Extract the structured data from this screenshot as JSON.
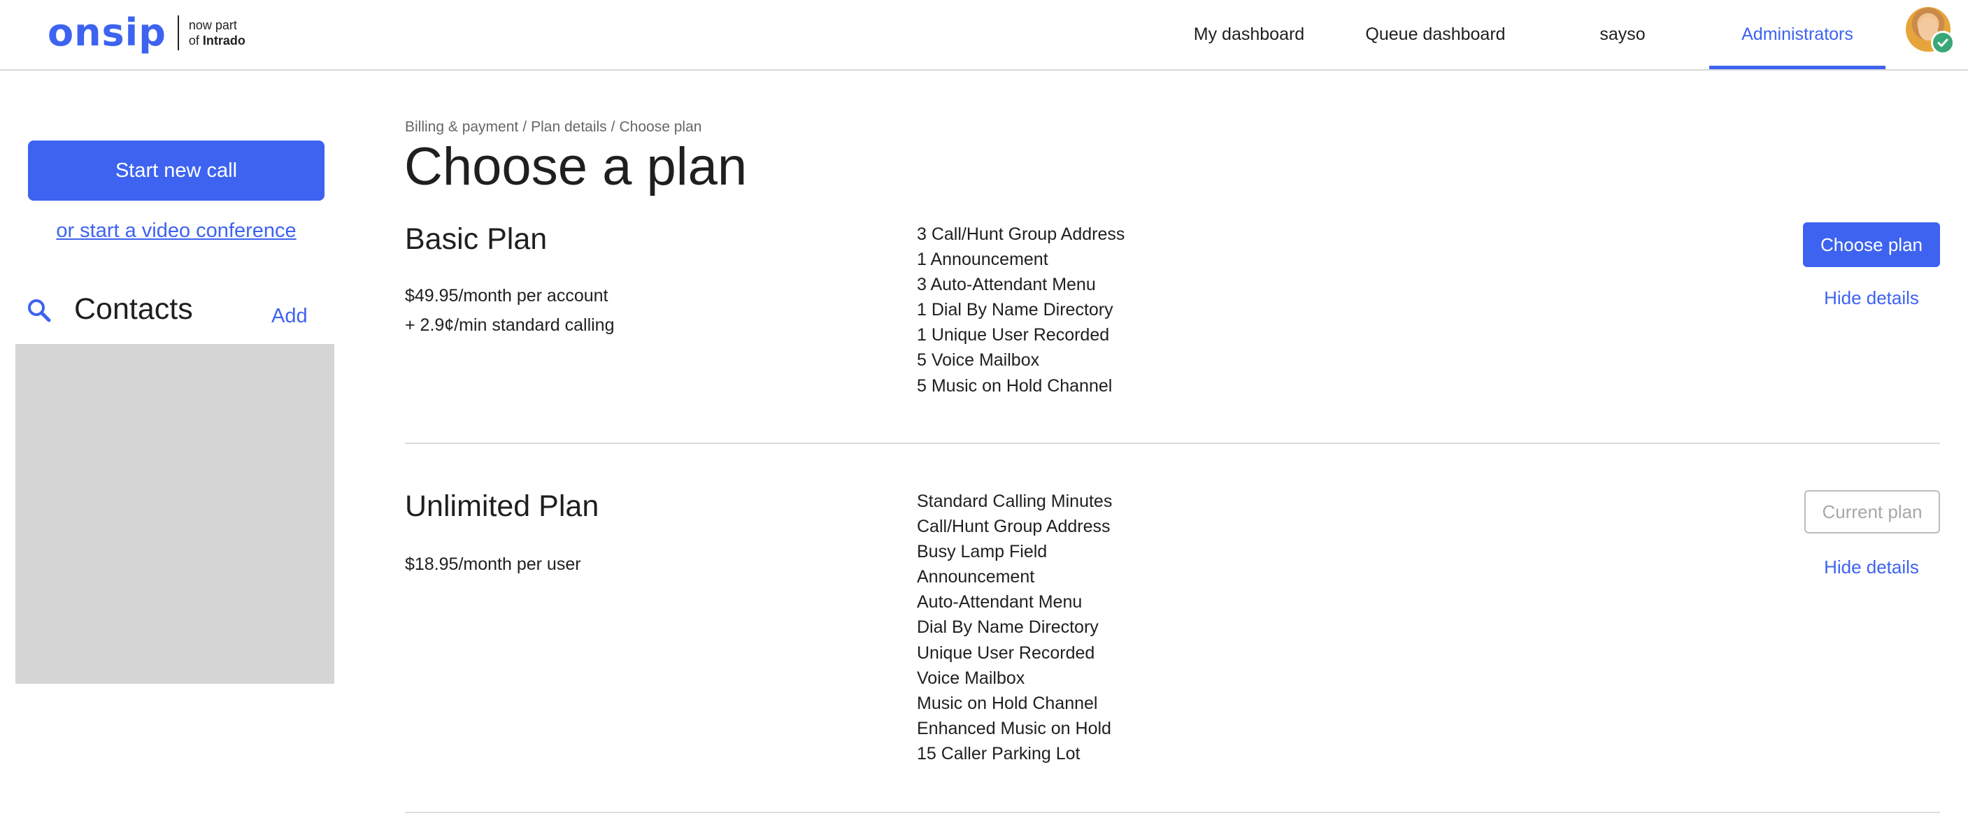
{
  "logo": {
    "word": "onsip",
    "sub_line1": "now part",
    "sub_line2_prefix": "of ",
    "sub_line2_brand": "Intrado"
  },
  "nav": {
    "my_dashboard": "My dashboard",
    "queue_dashboard": "Queue dashboard",
    "sayso": "sayso",
    "administrators": "Administrators"
  },
  "sidebar": {
    "start_call": "Start new call",
    "video_conference": "or start a video conference",
    "contacts_title": "Contacts",
    "contacts_add": "Add"
  },
  "breadcrumb": {
    "items": [
      "Billing & payment",
      "Plan details",
      "Choose plan"
    ],
    "separator": "/"
  },
  "page_title": "Choose a plan",
  "plans": [
    {
      "name": "Basic Plan",
      "price_lines": [
        "$49.95/month per account",
        "+ 2.9¢/min standard calling"
      ],
      "features": [
        "3 Call/Hunt Group Address",
        "1 Announcement",
        "3 Auto-Attendant Menu",
        "1 Dial By Name Directory",
        "1 Unique User Recorded",
        "5 Voice Mailbox",
        "5 Music on Hold Channel"
      ],
      "action_label": "Choose plan",
      "hide_label": "Hide details"
    },
    {
      "name": "Unlimited Plan",
      "price_lines": [
        "$18.95/month per user"
      ],
      "features": [
        "Standard Calling Minutes",
        "Call/Hunt Group Address",
        "Busy Lamp Field",
        "Announcement",
        "Auto-Attendant Menu",
        "Dial By Name Directory",
        "Unique User Recorded",
        "Voice Mailbox",
        "Music on Hold Channel",
        "Enhanced Music on Hold",
        "15 Caller Parking Lot"
      ],
      "action_label": "Current plan",
      "hide_label": "Hide details"
    }
  ],
  "colors": {
    "accent": "#3d63f0",
    "status_online": "#3aa776",
    "panel_gray": "#d5d5d5"
  }
}
